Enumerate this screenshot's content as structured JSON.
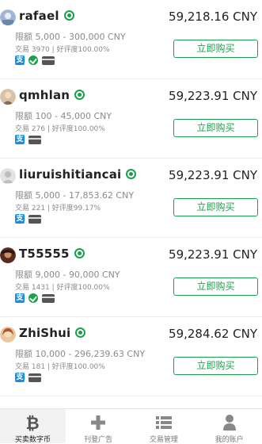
{
  "listings": [
    {
      "username": "rafael",
      "price": "59,218.16 CNY",
      "limit": "限额 5,000 - 300,000 CNY",
      "stats": "交易 3970 | 好评度100.00%",
      "buy_label": "立即购买",
      "payments": [
        "alipay",
        "wechat",
        "bank"
      ]
    },
    {
      "username": "qmhlan",
      "price": "59,223.91 CNY",
      "limit": "限额 100 - 45,000 CNY",
      "stats": "交易 276 | 好评度100.00%",
      "buy_label": "立即购买",
      "payments": [
        "alipay",
        "bank"
      ]
    },
    {
      "username": "liuruishitiancai",
      "price": "59,223.91 CNY",
      "limit": "限额 5,000 - 17,853.62 CNY",
      "stats": "交易 221 | 好评度99.17%",
      "buy_label": "立即购买",
      "payments": [
        "alipay",
        "bank"
      ]
    },
    {
      "username": "T55555",
      "price": "59,223.91 CNY",
      "limit": "限额 9,000 - 90,000 CNY",
      "stats": "交易 1431 | 好评度100.00%",
      "buy_label": "立即购买",
      "payments": [
        "alipay",
        "wechat",
        "bank"
      ]
    },
    {
      "username": "ZhiShui",
      "price": "59,284.62 CNY",
      "limit": "限额 10,000 - 296,239.63 CNY",
      "stats": "交易 181 | 好评度100.00%",
      "buy_label": "立即购买",
      "payments": [
        "alipay",
        "bank"
      ]
    }
  ],
  "tabbar": {
    "tabs": [
      {
        "label": "买卖数字币",
        "icon": "bitcoin-icon",
        "active": true
      },
      {
        "label": "刊登广告",
        "icon": "plus-icon",
        "active": false
      },
      {
        "label": "交易管理",
        "icon": "list-icon",
        "active": false
      },
      {
        "label": "我的账户",
        "icon": "user-icon",
        "active": false
      }
    ]
  },
  "colors": {
    "accent": "#19a04b",
    "alipay": "#1a8fdf",
    "text": "#222222",
    "muted": "#8a8a8a"
  }
}
